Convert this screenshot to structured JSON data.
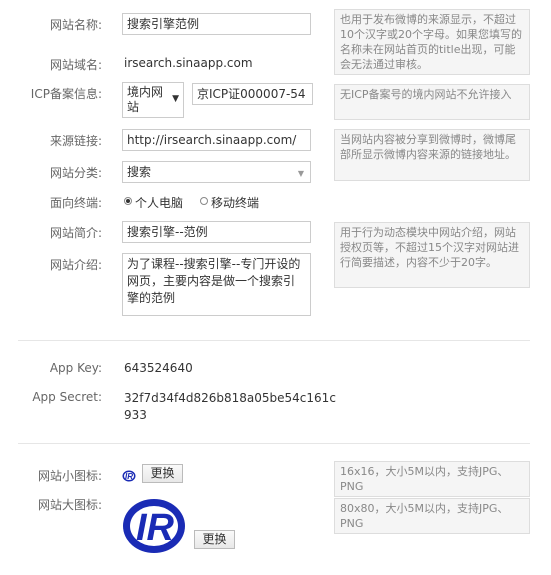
{
  "form": {
    "site_name_label": "网站名称:",
    "site_name_value": "搜索引擎范例",
    "site_name_hint": "也用于发布微博的来源显示，不超过10个汉字或20个字母。如果您填写的名称未在网站首页的title出现，可能会无法通过审核。",
    "domain_label": "网站域名:",
    "domain_value": "irsearch.sinaapp.com",
    "icp_label": "ICP备案信息:",
    "icp_select_value": "境内网站",
    "icp_value": "京ICP证000007-54",
    "icp_hint": "无ICP备案号的境内网站不允许接入",
    "source_link_label": "来源链接:",
    "source_link_value": "http://irsearch.sinaapp.com/",
    "source_link_hint": "当网站内容被分享到微博时，微博尾部所显示微博内容来源的链接地址。",
    "category_label": "网站分类:",
    "category_value": "搜索",
    "terminal_label": "面向终端:",
    "terminal_option_pc": "个人电脑",
    "terminal_option_mobile": "移动终端",
    "intro_short_label": "网站简介:",
    "intro_short_value": "搜索引擎--范例",
    "intro_short_hint": "用于行为动态模块中网站介绍，网站授权页等，不超过15个汉字对网站进行简要描述，内容不少于20字。",
    "intro_long_label": "网站介绍:",
    "intro_long_value": "为了课程--搜索引擎--专门开设的网页，主要内容是做一个搜索引擎的范例"
  },
  "app": {
    "key_label": "App Key:",
    "key_value": "643524640",
    "secret_label": "App Secret:",
    "secret_value": "32f7d34f4d826b818a05be54c161c933"
  },
  "icons": {
    "small_label": "网站小图标:",
    "small_hint": "16x16，大小5M以内，支持JPG、PNG",
    "large_label": "网站大图标:",
    "large_hint": "80x80，大小5M以内，支持JPG、PNG",
    "replace_label": "更换",
    "logo_text": "IR"
  }
}
